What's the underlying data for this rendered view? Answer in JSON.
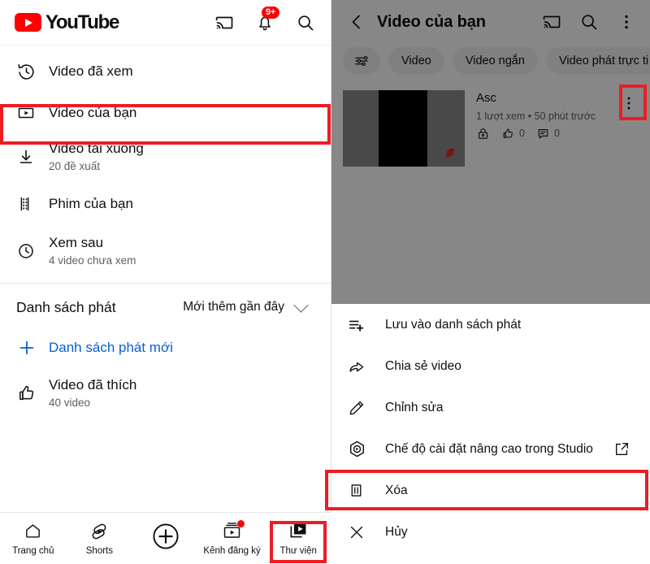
{
  "left_panel": {
    "header": {
      "logo_text": "YouTube",
      "cast_icon": "cast-icon",
      "notifications_icon": "bell-icon",
      "notifications_badge": "9+",
      "search_icon": "search-icon"
    },
    "library_items": [
      {
        "icon": "history-icon",
        "title": "Video đã xem",
        "subtitle": ""
      },
      {
        "icon": "play-box-icon",
        "title": "Video của bạn",
        "subtitle": ""
      },
      {
        "icon": "download-icon",
        "title": "Video tải xuống",
        "subtitle": "20 đề xuất"
      },
      {
        "icon": "film-icon",
        "title": "Phim của bạn",
        "subtitle": ""
      },
      {
        "icon": "clock-icon",
        "title": "Xem sau",
        "subtitle": "4 video chưa xem"
      }
    ],
    "playlists": {
      "section_title": "Danh sách phát",
      "sort_label": "Mới thêm gần đây",
      "sort_icon": "chevron-down-icon",
      "new_playlist_label": "Danh sách phát mới",
      "new_playlist_icon": "plus-icon",
      "items": [
        {
          "icon": "thumbs-up-icon",
          "title": "Video đã thích",
          "subtitle": "40 video"
        }
      ]
    },
    "bottom_nav": [
      {
        "icon": "home-icon",
        "label": "Trang chủ",
        "badge": false
      },
      {
        "icon": "shorts-icon",
        "label": "Shorts",
        "badge": false
      },
      {
        "icon": "plus-circle-icon",
        "label": "",
        "badge": false
      },
      {
        "icon": "subscriptions-icon",
        "label": "Kênh đăng ký",
        "badge": true
      },
      {
        "icon": "library-icon",
        "label": "Thư viện",
        "badge": false
      }
    ]
  },
  "right_panel": {
    "header": {
      "back_icon": "chevron-left-icon",
      "title": "Video của bạn",
      "cast_icon": "cast-icon",
      "search_icon": "search-icon",
      "overflow_icon": "kebab-menu-icon"
    },
    "chips": [
      {
        "icon": "filter-icon",
        "label": ""
      },
      {
        "icon": "",
        "label": "Video"
      },
      {
        "icon": "",
        "label": "Video ngắn"
      },
      {
        "icon": "",
        "label": "Video phát trực ti"
      }
    ],
    "video": {
      "title": "Asc",
      "stats": "1 lượt xem • 50 phút trước",
      "privacy_icon": "lock-icon",
      "likes_icon": "thumbs-up-icon",
      "likes_count": "0",
      "comments_icon": "comment-icon",
      "comments_count": "0",
      "shorts_badge_icon": "shorts-icon",
      "overflow_icon": "kebab-menu-icon"
    },
    "sheet_items": [
      {
        "icon": "playlist-add-icon",
        "label": "Lưu vào danh sách phát",
        "external": false
      },
      {
        "icon": "share-icon",
        "label": "Chia sẻ video",
        "external": false
      },
      {
        "icon": "pencil-icon",
        "label": "Chỉnh sửa",
        "external": false
      },
      {
        "icon": "studio-icon",
        "label": "Chế độ cài đặt nâng cao trong Studio",
        "external": true
      },
      {
        "icon": "trash-icon",
        "label": "Xóa",
        "external": false
      },
      {
        "icon": "close-icon",
        "label": "Hủy",
        "external": false
      }
    ]
  },
  "highlights": {
    "color": "#ee1c24",
    "boxes": [
      "video-cua-ban-row",
      "kebab-menu",
      "xoa-row",
      "thu-vien-tab"
    ]
  }
}
